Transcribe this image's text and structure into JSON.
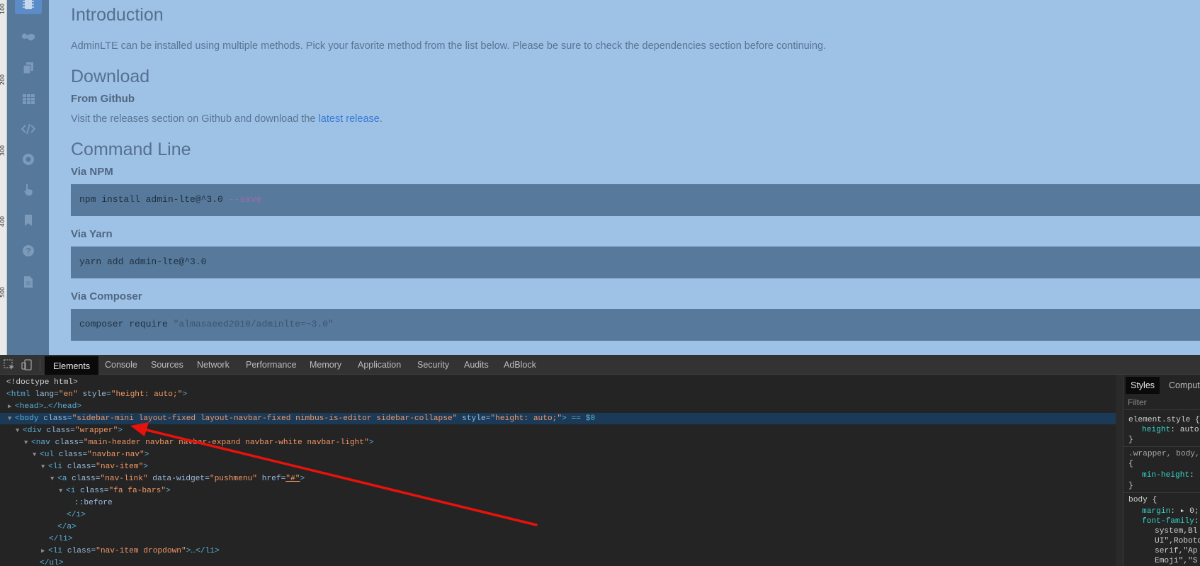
{
  "ruler": {
    "labels": [
      "100",
      "200",
      "300",
      "400",
      "500"
    ]
  },
  "sidebar": {
    "icons": [
      "microchip-icon",
      "handshake-icon",
      "copy-icon",
      "table-icon",
      "code-icon",
      "chrome-icon",
      "hand-pointer-icon",
      "bookmark-icon",
      "question-circle-icon",
      "file-icon"
    ]
  },
  "content": {
    "intro_title": "Introduction",
    "intro_text": "AdminLTE can be installed using multiple methods. Pick your favorite method from the list below. Please be sure to check the dependencies section before continuing.",
    "download_title": "Download",
    "github_title": "From Github",
    "github_text": "Visit the releases section on Github and download the ",
    "github_link": "latest release",
    "github_end": ".",
    "cli_title": "Command Line",
    "npm_title": "Via NPM",
    "npm_cmd": "npm install admin-lte@^3.0 ",
    "npm_flag": "--save",
    "yarn_title": "Via Yarn",
    "yarn_cmd": "yarn add admin-lte@^3.0",
    "composer_title": "Via Composer",
    "composer_cmd": "composer require ",
    "composer_arg": "\"almasaeed2010/adminlte=~3.0\""
  },
  "devtools": {
    "tabs": [
      "Elements",
      "Console",
      "Sources",
      "Network",
      "Performance",
      "Memory",
      "Application",
      "Security",
      "Audits",
      "AdBlock"
    ],
    "active_tab": "Elements",
    "dom": {
      "doctype": "<!doctype html>",
      "html_open": "<html",
      "lang_attr": " lang=",
      "lang_val": "\"en\"",
      "style_attr": " style=",
      "html_style_val": "\"height: auto;\"",
      "close_bracket": ">",
      "head_collapsed": "<head>…</head>",
      "body_open": "<body",
      "class_attr": " class=",
      "body_class_val": "\"sidebar-mini layout-fixed layout-navbar-fixed nimbus-is-editor sidebar-collapse\"",
      "body_style_val": "\"height: auto;\"",
      "body_marker": "> == $0",
      "div_open": "<div",
      "wrapper_val": "\"wrapper\"",
      "nav_open": "<nav",
      "nav_class_val": "\"main-header navbar navbar-expand navbar-white navbar-light\"",
      "ul_open": "<ul",
      "ul_class_val": "\"navbar-nav\"",
      "li_open": "<li",
      "li_class_val": "\"nav-item\"",
      "a_open": "<a",
      "a_class_val": "\"nav-link\"",
      "data_widget_attr": " data-widget=",
      "data_widget_val": "\"pushmenu\"",
      "href_attr": " href=",
      "href_val": "\"#\"",
      "i_open": "<i",
      "i_class_val": "\"fa fa-bars\"",
      "before": "::before",
      "i_close": "</i>",
      "a_close": "</a>",
      "li_close": "</li>",
      "li_dropdown_val": "\"nav-item dropdown\"",
      "li_dropdown_tail": ">…</li>",
      "ul_close": "</ul>"
    },
    "styles_panel": {
      "tabs": [
        "Styles",
        "Comput"
      ],
      "filter_placeholder": "Filter",
      "element_style": "element.style {",
      "height_prop": "height",
      "height_val": ": auto",
      "close": "}",
      "wrapper_sel": ".wrapper, body,",
      "open_brace": "{",
      "min_height_prop": "min-height",
      "min_height_val": ":",
      "body_sel": "body {",
      "margin_prop": "margin",
      "margin_val": ": ▸ 0;",
      "font_family_prop": "font-family",
      "font_family_val": ":",
      "ff_1": "system,Bl",
      "ff_2": "UI\",Roboto",
      "ff_3": "serif,\"Ap",
      "ff_4": "Emoji\",\"S"
    }
  },
  "annotation": {
    "color": "#e8120c"
  }
}
